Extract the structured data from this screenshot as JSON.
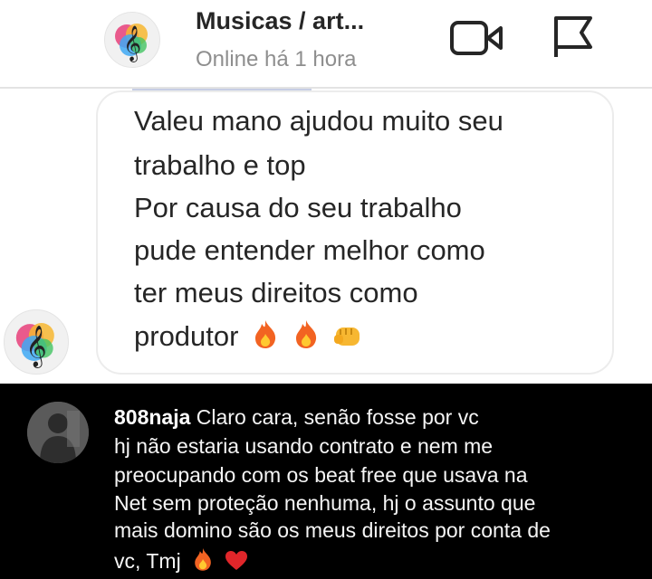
{
  "header": {
    "title": "Musicas / art...",
    "status": "Online há 1 hora",
    "icons": {
      "avatar": "treble-clef-icon",
      "video": "video-camera-icon",
      "flag": "flag-icon"
    }
  },
  "message": {
    "lines": [
      "Valeu mano ajudou muito seu",
      "trabalho e top",
      "Por causa do seu trabalho",
      "pude entender melhor como",
      "ter meus direitos como",
      "produtor"
    ],
    "emojis": [
      "fire",
      "fire",
      "fist-bump"
    ]
  },
  "comment": {
    "username": "808naja",
    "lines": [
      "Claro cara, senão fosse por vc",
      "hj não estaria usando contrato e nem me",
      "preocupando com os beat free que usava na",
      "Net sem proteção nenhuma, hj o assunto que",
      "mais domino são os meus direitos por conta de",
      "vc, Tmj"
    ],
    "emojis": [
      "fire",
      "red-heart"
    ]
  },
  "colors": {
    "text": "#262626",
    "muted": "#8e8e8e",
    "comment_bg": "#000000",
    "heart": "#e0262a",
    "fire": "#f26322"
  }
}
